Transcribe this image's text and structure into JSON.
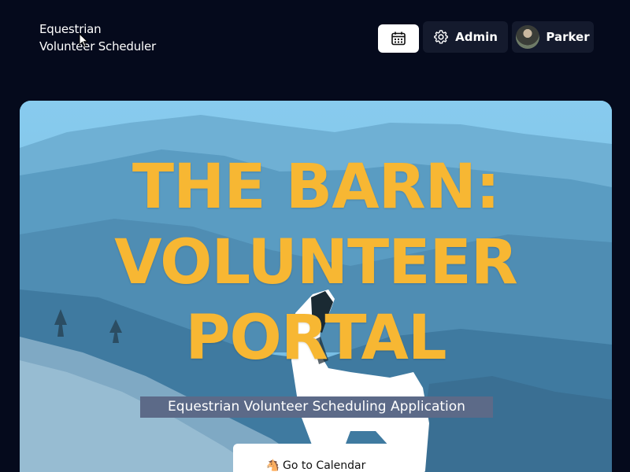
{
  "header": {
    "brand_line1": "Equestrian",
    "brand_line2": "Volunteer Scheduler",
    "nav": {
      "calendar_icon": "calendar-icon",
      "admin_icon": "gear-icon",
      "admin_label": "Admin",
      "user_name": "Parker"
    }
  },
  "hero": {
    "title_line1": "THE BARN:",
    "title_line2": "VOLUNTEER",
    "title_line3": "PORTAL",
    "subtitle": "Equestrian Volunteer Scheduling Application",
    "cta_icon": "horse-icon",
    "cta_label": "Go to Calendar"
  },
  "colors": {
    "background": "#050a1c",
    "nav_button": "#141a2d",
    "hero_sky": "#7ec6ea",
    "title": "#f7b733",
    "subtitle_bg": "#5c6a88"
  }
}
